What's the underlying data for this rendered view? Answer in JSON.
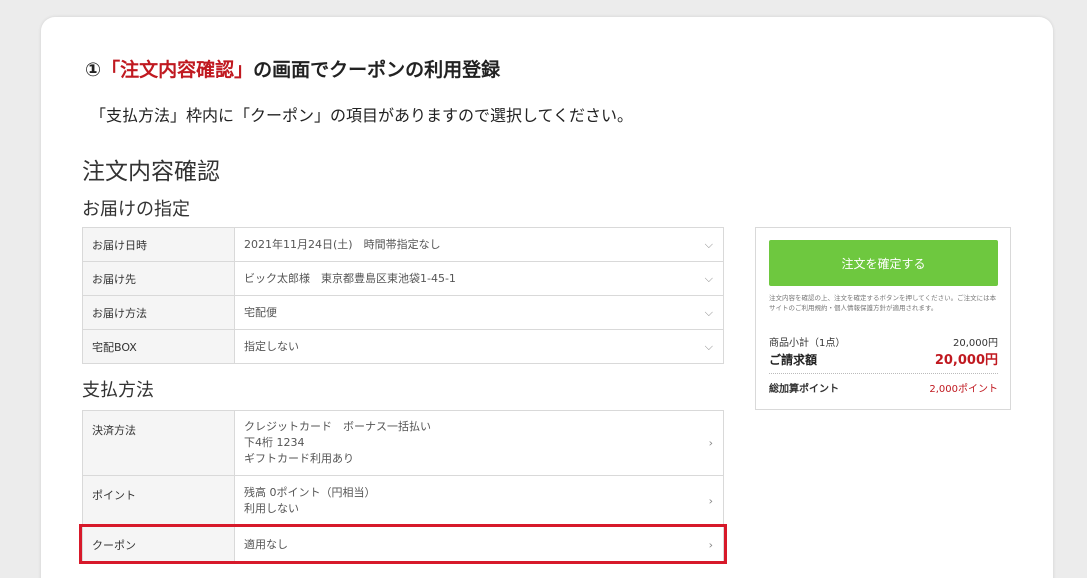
{
  "heading": {
    "number": "①",
    "accent": "「注文内容確認」",
    "rest": "の画面でクーポンの利用登録"
  },
  "intro": "「支払方法」枠内に「クーポン」の項目がありますので選択してください。",
  "page_title": "注文内容確認",
  "delivery": {
    "section_title": "お届けの指定",
    "rows": [
      {
        "label": "お届け日時",
        "value": "2021年11月24日(土)　時間帯指定なし",
        "arrow": "⌵"
      },
      {
        "label": "お届け先",
        "value": "ビック太郎様　東京都豊島区東池袋1-45-1",
        "arrow": "⌵"
      },
      {
        "label": "お届け方法",
        "value": "宅配便",
        "arrow": "⌵"
      },
      {
        "label": "宅配BOX",
        "value": "指定しない",
        "arrow": "⌵"
      }
    ]
  },
  "payment": {
    "section_title": "支払方法",
    "method": {
      "label": "決済方法",
      "lines": [
        "クレジットカード　ボーナス一括払い",
        "下4桁 1234",
        "ギフトカード利用あり"
      ],
      "arrow": "›"
    },
    "point": {
      "label": "ポイント",
      "lines": [
        "残高 0ポイント（円相当）",
        "利用しない"
      ],
      "arrow": "›"
    },
    "coupon": {
      "label": "クーポン",
      "value": "適用なし",
      "arrow": "›"
    }
  },
  "summary": {
    "confirm_label": "注文を確定する",
    "note": "注文内容を確認の上、注文を確定するボタンを押してください。ご注文には本サイトのご利用規約・個人情報保護方針が適用されます。",
    "subtotal_label": "商品小計（1点）",
    "subtotal_value": "20,000円",
    "billing_label": "ご請求額",
    "billing_value": "20,000円",
    "points_label": "総加算ポイント",
    "points_value": "2,000ポイント"
  },
  "colors": {
    "accent_red": "#c01920",
    "highlight_red": "#d7192a",
    "confirm_green": "#6ec83f",
    "table_header_bg": "#f5f5f5"
  },
  "icons": {
    "dropdown": "chevron-down-icon",
    "navigate": "chevron-right-icon"
  }
}
